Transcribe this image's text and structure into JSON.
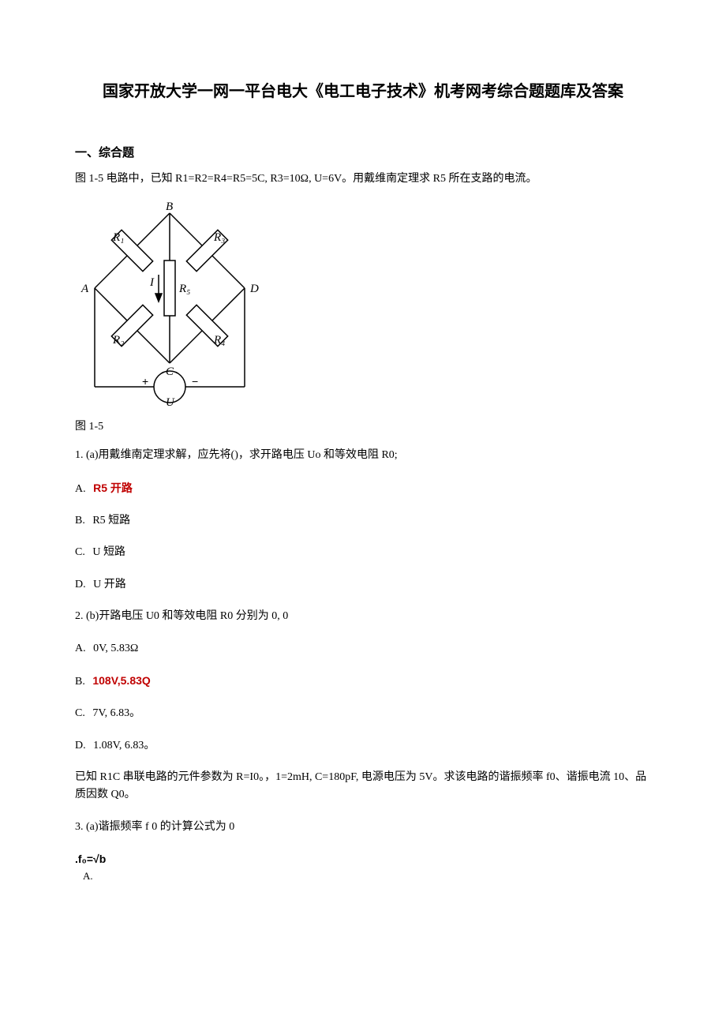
{
  "title": "国家开放大学一网一平台电大《电工电子技术》机考网考综合题题库及答案",
  "section_heading": "一、综合题",
  "intro_para": "图 1-5 电路中，已知 R1=R2=R4=R5=5C, R3=10Ω, U=6V。用戴维南定理求 R5 所在支路的电流。",
  "fig_caption": "图 1-5",
  "diagram": {
    "A": "A",
    "B": "B",
    "C": "C",
    "D": "D",
    "R1": "R₁",
    "R2": "R₂",
    "R3": "R₃",
    "R4": "R₄",
    "R5": "R₅",
    "I": "I",
    "U": "U",
    "plus": "+",
    "minus": "−"
  },
  "q1": {
    "stem": "1. (a)用戴维南定理求解，应先将()，求开路电压 Uo 和等效电阻 R0;",
    "A_label": "A.",
    "A_text": "R5 开路",
    "B_label": "B.",
    "B_text": "R5 短路",
    "C_label": "C.",
    "C_text": "U 短路",
    "D_label": "D.",
    "D_text": "U 开路"
  },
  "q2": {
    "stem": "2.  (b)开路电压 U0 和等效电阻 R0 分别为 0, 0",
    "A_label": "A.",
    "A_text": "0V, 5.83Ω",
    "B_label": "B.",
    "B_text": "108V,5.83Q",
    "C_label": "C.",
    "C_text": "7V, 6.83。",
    "D_label": "D.",
    "D_text": "1.08V, 6.83。"
  },
  "context2": "已知 R1C 串联电路的元件参数为 R=I0。，1=2mH, C=180pF, 电源电压为 5V。求该电路的谐振频率 f0、谐振电流 10、品质因数 Q0。",
  "q3": {
    "stem": "3.  (a)谐振频率 f 0 的计算公式为 0",
    "A_formula": ".f₀=√b",
    "A_sub": "A."
  }
}
